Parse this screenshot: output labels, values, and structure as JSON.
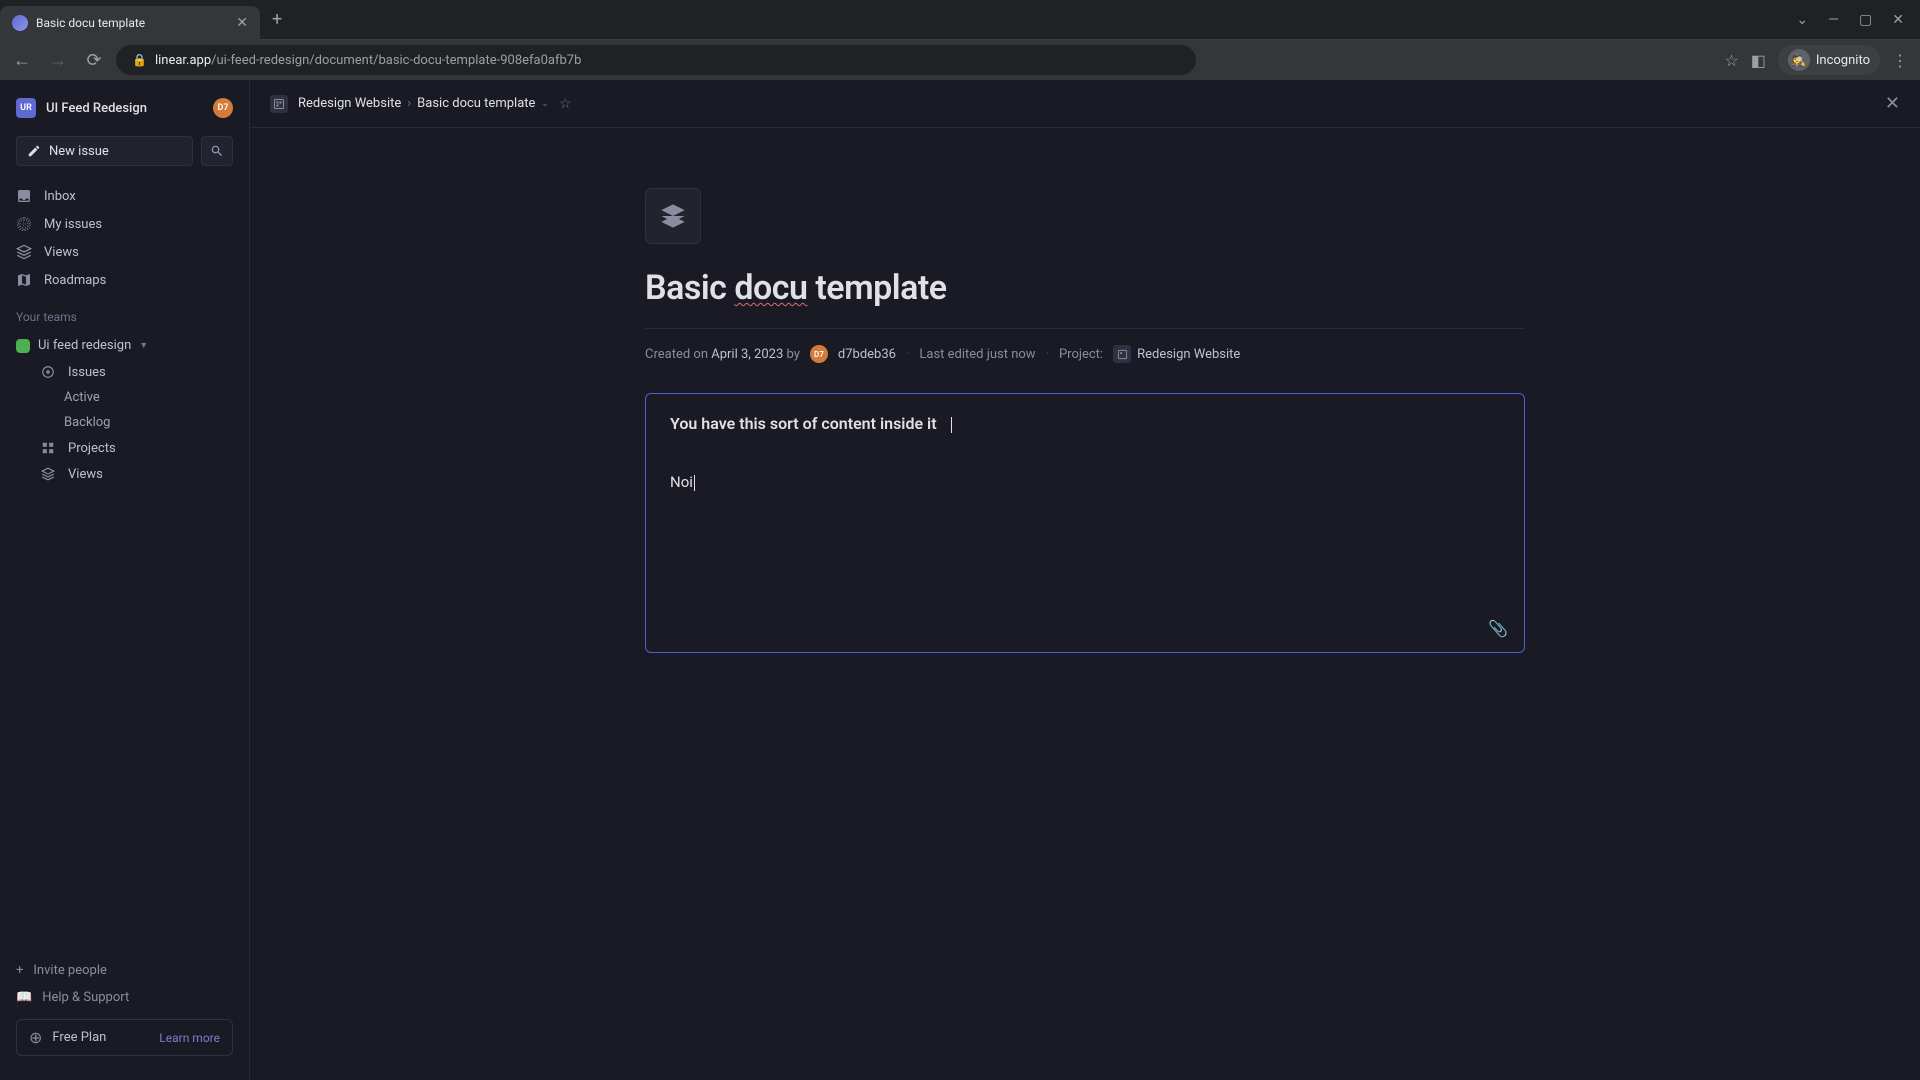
{
  "browser": {
    "tab_title": "Basic docu template",
    "url_domain": "linear.app",
    "url_path": "/ui-feed-redesign/document/basic-docu-template-908efa0afb7b",
    "incognito_label": "Incognito"
  },
  "sidebar": {
    "workspace_initials": "UR",
    "workspace_name": "UI Feed Redesign",
    "user_badge": "D7",
    "new_issue_label": "New issue",
    "nav": {
      "inbox": "Inbox",
      "my_issues": "My issues",
      "views": "Views",
      "roadmaps": "Roadmaps"
    },
    "teams_label": "Your teams",
    "team_name": "Ui feed redesign",
    "team_nav": {
      "issues": "Issues",
      "active": "Active",
      "backlog": "Backlog",
      "projects": "Projects",
      "views": "Views"
    },
    "footer": {
      "invite": "Invite people",
      "help": "Help & Support",
      "plan": "Free Plan",
      "learn_more": "Learn more"
    }
  },
  "topbar": {
    "project": "Redesign Website",
    "separator": "›",
    "document": "Basic docu template"
  },
  "document": {
    "title_part1": "Basic ",
    "title_misspell": "docu",
    "title_part2": " template",
    "meta": {
      "created_prefix": "Created on ",
      "created_date": "April 3, 2023",
      "by_label": " by ",
      "author_badge": "D7",
      "author_name": "d7bdeb36",
      "edited_label": "Last edited just now",
      "project_label": "Project:",
      "project_name": "Redesign Website"
    },
    "editor": {
      "heading": "You have this sort of content inside it",
      "body": "Noi"
    }
  }
}
